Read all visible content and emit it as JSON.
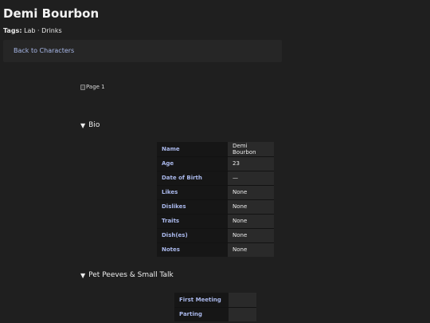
{
  "character": {
    "name": "Demi Bourbon",
    "tags_label": "Tags:",
    "tags_value": "Lab · Drinks"
  },
  "nav": {
    "back_label": "Back to Characters"
  },
  "image": {
    "alt_text": "Page 1"
  },
  "sections": {
    "bio": {
      "triangle": "▼",
      "title": "Bio",
      "rows": [
        {
          "key": "Name",
          "value": "Demi Bourbon"
        },
        {
          "key": "Age",
          "value": "23"
        },
        {
          "key": "Date of Birth",
          "value": "—"
        },
        {
          "key": "Likes",
          "value": "None"
        },
        {
          "key": "Dislikes",
          "value": "None"
        },
        {
          "key": "Traits",
          "value": "None"
        },
        {
          "key": "Dish(es)",
          "value": "None"
        },
        {
          "key": "Notes",
          "value": "None"
        }
      ]
    },
    "peeves": {
      "triangle": "▼",
      "title": "Pet Peeves & Small Talk",
      "rows": [
        {
          "key": "First Meeting",
          "value": ""
        },
        {
          "key": "Parting",
          "value": ""
        }
      ]
    }
  },
  "colors": {
    "background": "#1f1f1f",
    "panel": "#262626",
    "link": "#a9b9ea",
    "table_key_bg": "#161616",
    "table_value_bg": "#2a2a2a",
    "table_key_text": "#a9b7ea"
  }
}
